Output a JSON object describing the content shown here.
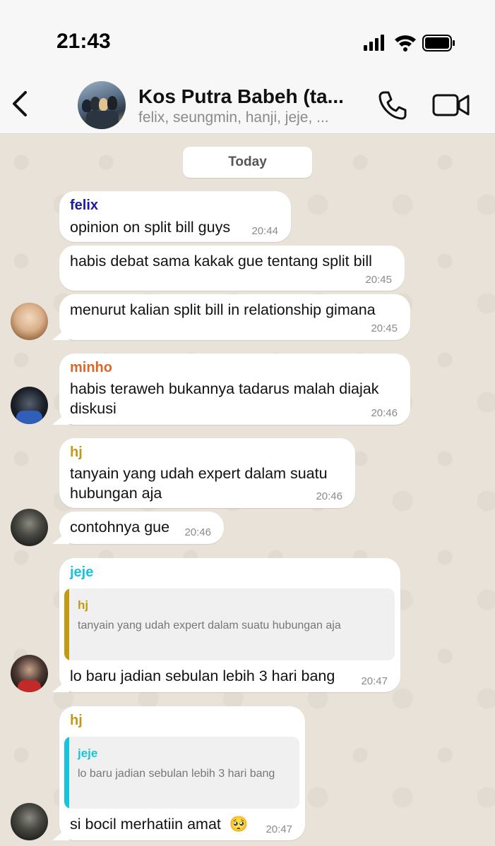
{
  "status_bar": {
    "time": "21:43"
  },
  "header": {
    "title": "Kos Putra Babeh (ta...",
    "subtitle": "felix, seungmin, hanji, jeje, ..."
  },
  "chat": {
    "date_label": "Today",
    "messages": [
      {
        "sender": "felix",
        "sender_color": "#1b1b9e",
        "text": "opinion on split bill guys",
        "time": "20:44"
      },
      {
        "text": "habis debat sama kakak gue tentang split bill",
        "time": "20:45"
      },
      {
        "text": "menurut kalian split bill in relationship gimana",
        "time": "20:45"
      },
      {
        "sender": "minho",
        "sender_color": "#d9692a",
        "text": "habis teraweh bukannya tadarus malah diajak diskusi",
        "time": "20:46"
      },
      {
        "sender": "hj",
        "sender_color": "#c39a16",
        "text": "tanyain yang udah expert dalam suatu hubungan aja",
        "time": "20:46"
      },
      {
        "text": "contohnya gue",
        "time": "20:46"
      },
      {
        "sender": "jeje",
        "sender_color": "#17c4dc",
        "quote_name": "hj",
        "quote_color": "#c39a16",
        "quote_text": "tanyain yang udah expert dalam suatu hubungan aja",
        "text": "lo baru jadian sebulan lebih 3 hari bang",
        "time": "20:47"
      },
      {
        "sender": "hj",
        "sender_color": "#c39a16",
        "quote_name": "jeje",
        "quote_color": "#17c4dc",
        "quote_text": "lo baru jadian sebulan lebih 3 hari bang",
        "text": "si bocil merhatiin amat",
        "emoji": "🥺",
        "time": "20:47"
      }
    ]
  }
}
